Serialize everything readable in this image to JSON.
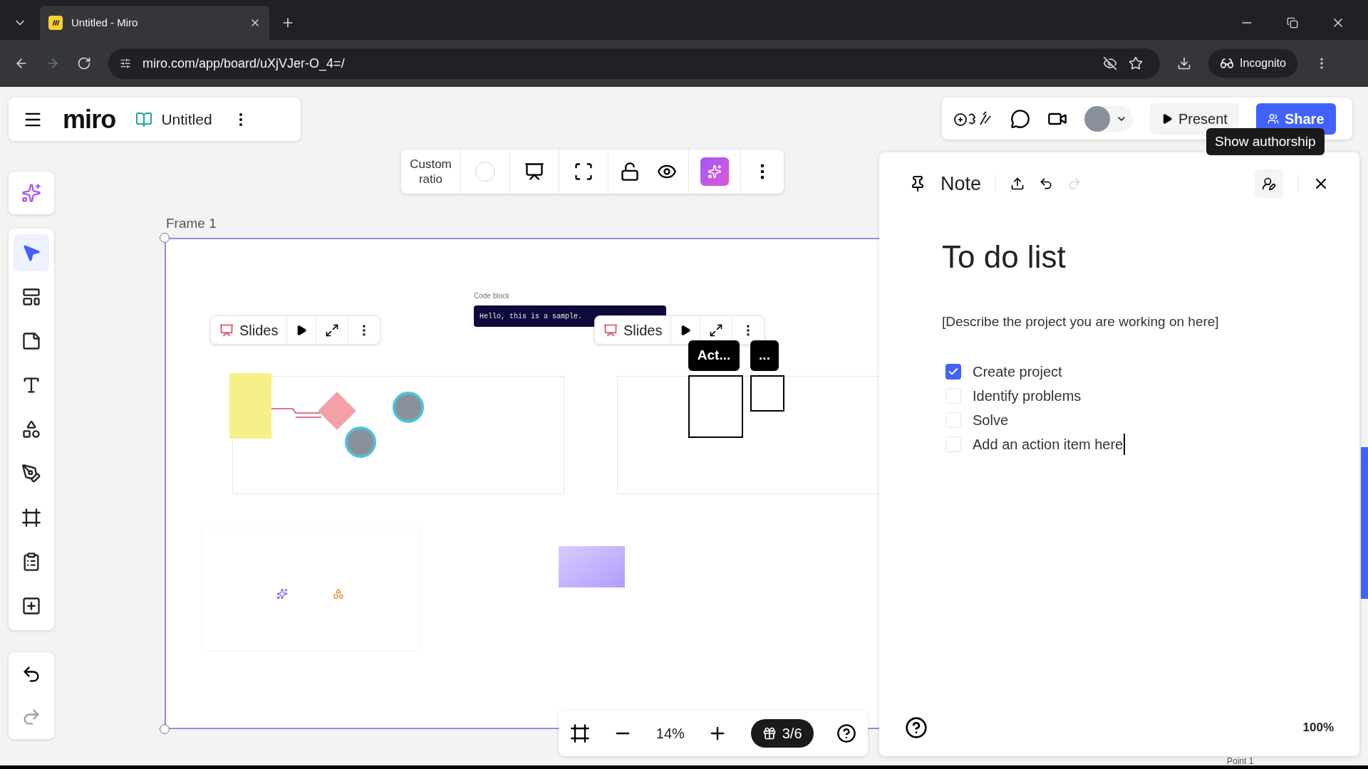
{
  "browser": {
    "tab_title": "Untitled - Miro",
    "url": "miro.com/app/board/uXjVJer-O_4=/",
    "profile": "Incognito"
  },
  "board_bar": {
    "logo": "miro",
    "board_name": "Untitled"
  },
  "collab_bar": {
    "present": "Present",
    "share": "Share",
    "tooltip": "Show authorship"
  },
  "left_toolbar": {
    "tools": [
      {
        "kind": "select",
        "selected": true
      },
      {
        "kind": "templates",
        "selected": false
      },
      {
        "kind": "sticky",
        "selected": false
      },
      {
        "kind": "text",
        "selected": false
      },
      {
        "kind": "shapes",
        "selected": false
      },
      {
        "kind": "pen",
        "selected": false
      },
      {
        "kind": "frame",
        "selected": false
      },
      {
        "kind": "notes",
        "selected": false
      },
      {
        "kind": "more",
        "selected": false
      }
    ]
  },
  "frame_toolbar": {
    "ratio": "Custom ratio"
  },
  "canvas": {
    "frame_label": "Frame 1",
    "code_label": "Code block",
    "code_text": "Hello, this is a sample.",
    "slides_toolbars": [
      {
        "label": "Slides"
      },
      {
        "label": "Slides"
      }
    ],
    "cards": [
      "Act...",
      "..."
    ],
    "footer_text": "Point 1"
  },
  "note": {
    "title": "Note",
    "heading": "To do list",
    "description": "[Describe the project you are working on here]",
    "items": [
      {
        "text": "Create project",
        "checked": true
      },
      {
        "text": "Identify problems",
        "checked": false
      },
      {
        "text": "Solve",
        "checked": false
      },
      {
        "text": "Add an action item here",
        "checked": false
      }
    ],
    "zoom": "100%"
  },
  "zoom_bar": {
    "zoom": "14%",
    "pages": "3/6"
  }
}
